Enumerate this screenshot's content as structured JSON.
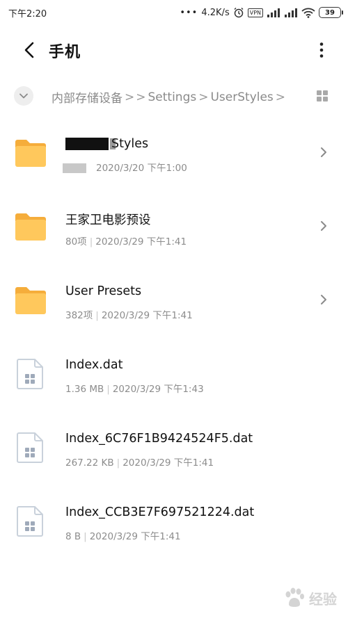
{
  "status_bar": {
    "time": "下午2:20",
    "network_speed": "4.2K/s",
    "vpn": "VPN",
    "battery": "39"
  },
  "header": {
    "title": "手机"
  },
  "breadcrumb": {
    "root": "内部存储设备",
    "extra_sep": ">",
    "items": [
      "Settings",
      "UserStyles"
    ]
  },
  "files": [
    {
      "name_suffix": "Styles",
      "meta_date": "2020/3/20 下午1:00",
      "type": "folder"
    },
    {
      "name": "王家卫电影预设",
      "meta_count": "80项",
      "meta_date": "2020/3/29 下午1:41",
      "type": "folder"
    },
    {
      "name": "User Presets",
      "meta_count": "382项",
      "meta_date": "2020/3/29 下午1:41",
      "type": "folder"
    },
    {
      "name": "Index.dat",
      "meta_count": "1.36 MB",
      "meta_date": "2020/3/29 下午1:43",
      "type": "file"
    },
    {
      "name": "Index_6C76F1B9424524F5.dat",
      "meta_count": "267.22 KB",
      "meta_date": "2020/3/29 下午1:41",
      "type": "file"
    },
    {
      "name": "Index_CCB3E7F697521224.dat",
      "meta_count": "8 B",
      "meta_date": "2020/3/29 下午1:41",
      "type": "file"
    }
  ],
  "colors": {
    "folder": "#FFC85C",
    "folder_tab": "#F5AD3B",
    "file_outline": "#C9D1DB",
    "file_glyph": "#9FAABA"
  },
  "watermark": "经验"
}
